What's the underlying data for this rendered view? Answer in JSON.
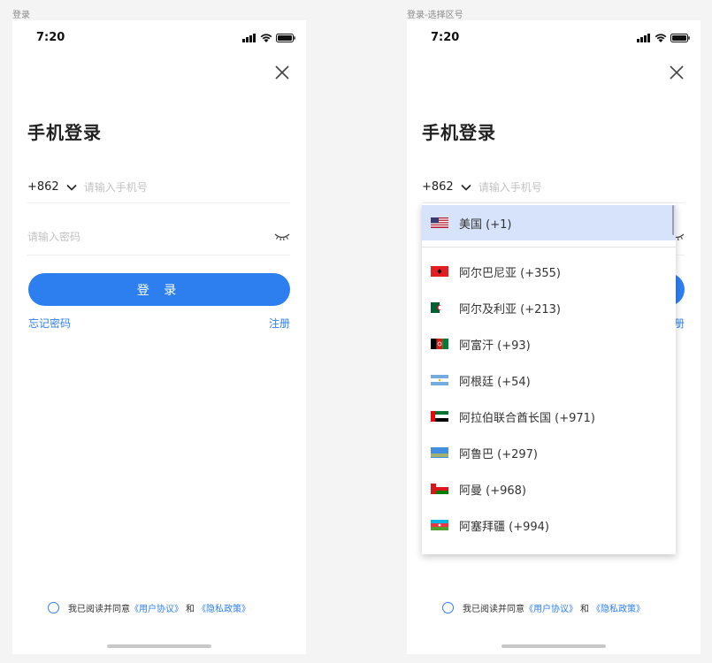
{
  "frames": {
    "login_label": "登录",
    "select_label": "登录-选择区号"
  },
  "status": {
    "time": "7:20"
  },
  "login": {
    "title": "手机登录",
    "country_code": "+862",
    "phone_placeholder": "请输入手机号",
    "password_placeholder": "请输入密码",
    "login_button": "登 录",
    "forgot_password": "忘记密码",
    "register": "注册"
  },
  "agreement": {
    "prefix": "我已阅读并同意",
    "user_agreement": "《用户协议》",
    "and": "和",
    "privacy_policy": "《隐私政策》"
  },
  "country_dropdown": {
    "selected": {
      "label": "美国 (+1)",
      "flag": "us-flag"
    },
    "items": [
      {
        "label": "阿尔巴尼亚 (+355)",
        "flag": "albania-flag"
      },
      {
        "label": "阿尔及利亚 (+213)",
        "flag": "algeria-flag"
      },
      {
        "label": "阿富汗 (+93)",
        "flag": "afghanistan-flag"
      },
      {
        "label": "阿根廷 (+54)",
        "flag": "argentina-flag"
      },
      {
        "label": "阿拉伯联合酋长国 (+971)",
        "flag": "uae-flag"
      },
      {
        "label": "阿鲁巴 (+297)",
        "flag": "aruba-flag"
      },
      {
        "label": "阿曼 (+968)",
        "flag": "oman-flag"
      },
      {
        "label": "阿塞拜疆 (+994)",
        "flag": "azerbaijan-flag"
      }
    ]
  },
  "colors": {
    "accent": "#2d7ff0",
    "selected_row": "#d6e3fa",
    "background": "#f4f4f4"
  },
  "icons": [
    "signal-icon",
    "wifi-icon",
    "battery-icon",
    "close-icon",
    "chevron-down-icon",
    "eye-closed-icon",
    "radio-icon"
  ]
}
